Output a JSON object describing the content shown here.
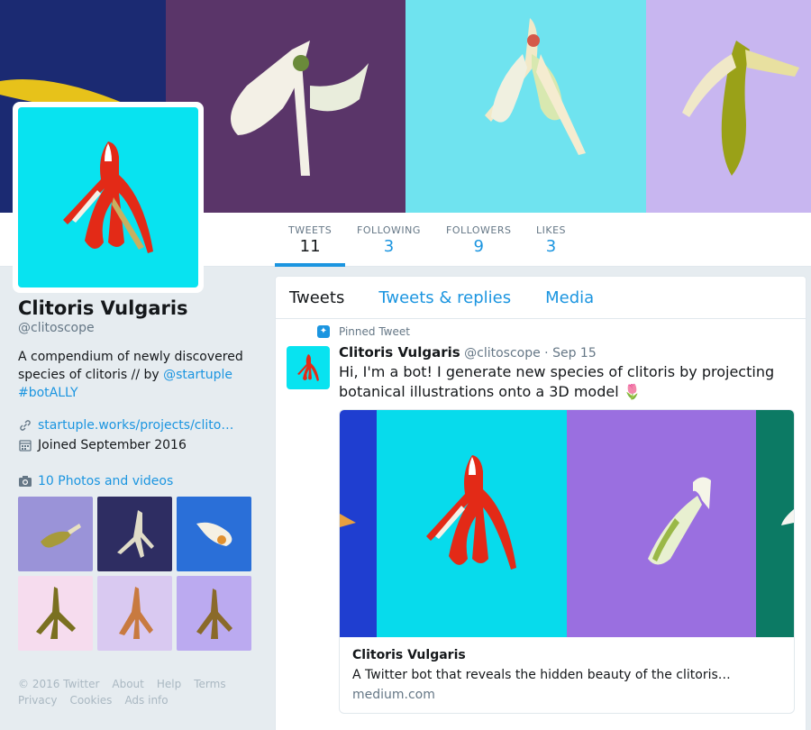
{
  "profile": {
    "name": "Clitoris Vulgaris",
    "handle": "@clitoscope",
    "bio_text": "A compendium of newly discovered species of clitoris // by ",
    "bio_mention": "@startuple",
    "bio_hashtag": "#botALLY",
    "website": "startuple.works/projects/clito…",
    "joined": "Joined September 2016",
    "photos_label": "10 Photos and videos"
  },
  "stats": [
    {
      "label": "TWEETS",
      "value": "11"
    },
    {
      "label": "FOLLOWING",
      "value": "3"
    },
    {
      "label": "FOLLOWERS",
      "value": "9"
    },
    {
      "label": "LIKES",
      "value": "3"
    }
  ],
  "tabs": [
    "Tweets",
    "Tweets & replies",
    "Media"
  ],
  "pinned_tweet": {
    "pinned_label": "Pinned Tweet",
    "author": "Clitoris Vulgaris",
    "handle_date": "@clitoscope · Sep 15",
    "text": "Hi, I'm a bot! I generate new species of clitoris by projecting botanical illustrations onto a 3D model 🌷",
    "card_title": "Clitoris Vulgaris",
    "card_desc": "A Twitter bot that reveals the hidden beauty of the clitoris…",
    "card_domain": "medium.com"
  },
  "footer": {
    "line1": [
      "© 2016 Twitter",
      "About",
      "Help",
      "Terms"
    ],
    "line2": [
      "Privacy",
      "Cookies",
      "Ads info"
    ]
  },
  "colors": {
    "accent": "#1b95e0",
    "avatar_bg": "#08e3f0"
  }
}
